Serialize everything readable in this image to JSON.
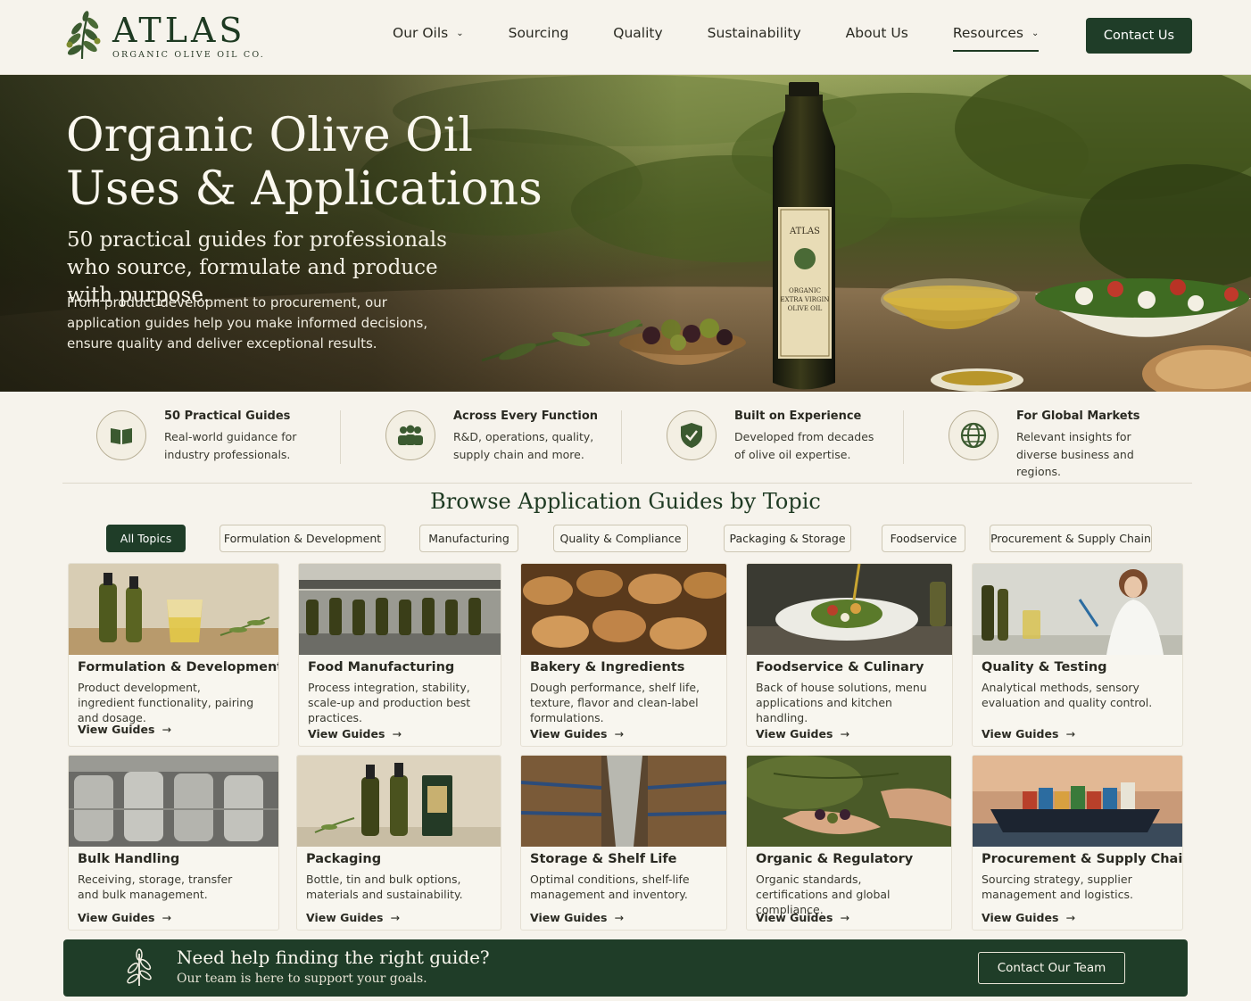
{
  "brand": {
    "name": "ATLAS",
    "tagline": "ORGANIC OLIVE OIL CO."
  },
  "nav": {
    "items": [
      {
        "label": "Our Oils",
        "dropdown": true
      },
      {
        "label": "Sourcing"
      },
      {
        "label": "Quality"
      },
      {
        "label": "Sustainability"
      },
      {
        "label": "About Us"
      },
      {
        "label": "Resources",
        "dropdown": true,
        "active": true
      }
    ],
    "contact_label": "Contact Us"
  },
  "hero": {
    "title_line1": "Organic Olive Oil",
    "title_line2": "Uses & Applications",
    "subtitle": "50 practical guides for professionals who source, formulate and produce with purpose.",
    "description": "From product development to procurement, our application guides help you make informed decisions, ensure quality and deliver exceptional results.",
    "bottle_label": {
      "brand": "ATLAS",
      "line1": "ORGANIC",
      "line2": "EXTRA VIRGIN",
      "line3": "OLIVE OIL"
    }
  },
  "features": [
    {
      "icon": "book-icon",
      "title": "50 Practical Guides",
      "description": "Real-world guidance for industry professionals."
    },
    {
      "icon": "people-icon",
      "title": "Across Every Function",
      "description": "R&D, operations, quality, supply chain and more."
    },
    {
      "icon": "shield-check-icon",
      "title": "Built on Experience",
      "description": "Developed from decades of olive oil expertise."
    },
    {
      "icon": "globe-icon",
      "title": "For Global Markets",
      "description": "Relevant insights for diverse business and regions."
    }
  ],
  "browse": {
    "title": "Browse Application Guides by Topic",
    "tabs": [
      "All Topics",
      "Formulation & Development",
      "Manufacturing",
      "Quality & Compliance",
      "Packaging & Storage",
      "Foodservice",
      "Procurement & Supply Chain"
    ],
    "active_tab": "All Topics"
  },
  "cards": [
    {
      "title": "Formulation & Development",
      "description": "Product development, ingredient functionality, pairing and dosage.",
      "link": "View Guides"
    },
    {
      "title": "Food Manufacturing",
      "description": "Process integration, stability, scale-up and production best practices.",
      "link": "View Guides"
    },
    {
      "title": "Bakery & Ingredients",
      "description": "Dough performance, shelf life, texture, flavor and clean-label formulations.",
      "link": "View Guides"
    },
    {
      "title": "Foodservice & Culinary",
      "description": "Back of house solutions, menu applications and kitchen handling.",
      "link": "View Guides"
    },
    {
      "title": "Quality & Testing",
      "description": "Analytical methods, sensory evaluation and quality control.",
      "link": "View Guides"
    },
    {
      "title": "Bulk Handling",
      "description": "Receiving, storage, transfer and bulk management.",
      "link": "View Guides"
    },
    {
      "title": "Packaging",
      "description": "Bottle, tin and bulk options, materials and sustainability.",
      "link": "View Guides"
    },
    {
      "title": "Storage & Shelf Life",
      "description": "Optimal conditions, shelf-life management and inventory.",
      "link": "View Guides"
    },
    {
      "title": "Organic & Regulatory",
      "description": "Organic standards, certifications and global compliance.",
      "link": "View Guides"
    },
    {
      "title": "Procurement & Supply Chain",
      "description": "Sourcing strategy, supplier management and logistics.",
      "link": "View Guides"
    }
  ],
  "cta": {
    "title": "Need help finding the right guide?",
    "subtitle": "Our team is here to support your goals.",
    "button_label": "Contact Our Team"
  },
  "colors": {
    "brand_green": "#1f3d28",
    "background": "#f6f3ec",
    "border": "#cdc6b3"
  }
}
